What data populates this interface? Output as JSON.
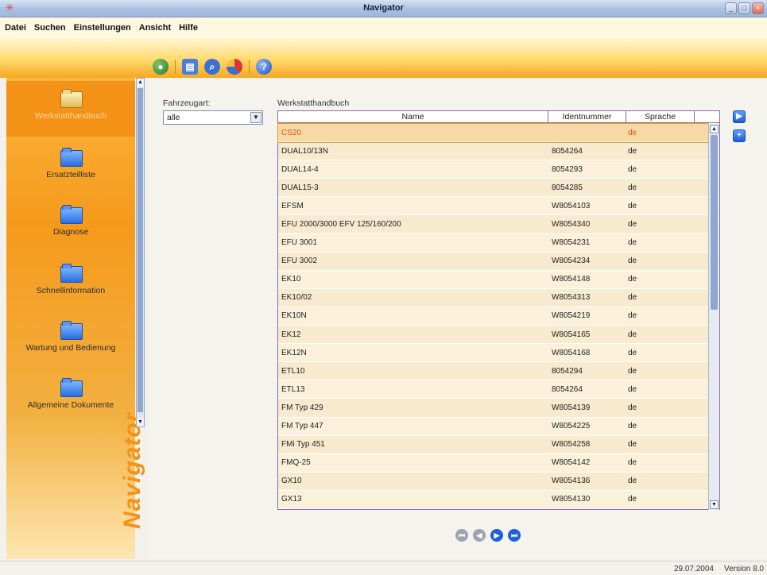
{
  "window": {
    "title": "Navigator"
  },
  "menu": [
    "Datei",
    "Suchen",
    "Einstellungen",
    "Ansicht",
    "Hilfe"
  ],
  "toolbar_icons": [
    "globe-icon",
    "print-icon",
    "search-icon",
    "pie-chart-icon",
    "help-icon"
  ],
  "sidebar": {
    "items": [
      {
        "label": "Werkstatthandbuch",
        "active": true
      },
      {
        "label": "Ersatzteilliste",
        "active": false
      },
      {
        "label": "Diagnose",
        "active": false
      },
      {
        "label": "Schnellinformation",
        "active": false
      },
      {
        "label": "Wartung und Bedienung",
        "active": false
      },
      {
        "label": "Allgemeine Dokumente",
        "active": false
      }
    ],
    "brand": "Navigator"
  },
  "filter": {
    "label": "Fahrzeugart:",
    "value": "alle"
  },
  "list": {
    "title": "Werkstatthandbuch",
    "columns": [
      "Name",
      "Identnummer",
      "Sprache"
    ],
    "rows": [
      [
        "CS20",
        "",
        "de"
      ],
      [
        "DUAL10/13N",
        "8054264",
        "de"
      ],
      [
        "DUAL14-4",
        "8054293",
        "de"
      ],
      [
        "DUAL15-3",
        "8054285",
        "de"
      ],
      [
        "EFSM",
        "W8054103",
        "de"
      ],
      [
        "EFU 2000/3000   EFV 125/160/200",
        "W8054340",
        "de"
      ],
      [
        "EFU 3001",
        "W8054231",
        "de"
      ],
      [
        "EFU 3002",
        "W8054234",
        "de"
      ],
      [
        "EK10",
        "W8054148",
        "de"
      ],
      [
        "EK10/02",
        "W8054313",
        "de"
      ],
      [
        "EK10N",
        "W8054219",
        "de"
      ],
      [
        "EK12",
        "W8054165",
        "de"
      ],
      [
        "EK12N",
        "W8054168",
        "de"
      ],
      [
        "ETL10",
        "8054294",
        "de"
      ],
      [
        "ETL13",
        "8054264",
        "de"
      ],
      [
        "FM Typ 429",
        "W8054139",
        "de"
      ],
      [
        "FM Typ 447",
        "W8054225",
        "de"
      ],
      [
        "FMi Typ 451",
        "W8054258",
        "de"
      ],
      [
        "FMQ-25",
        "W8054142",
        "de"
      ],
      [
        "GX10",
        "W8054136",
        "de"
      ],
      [
        "GX13",
        "W8054130",
        "de"
      ]
    ],
    "selected_row": 0
  },
  "status": {
    "date": "29.07.2004",
    "version": "Version 8.0"
  },
  "colors": {
    "accent": "#f39216",
    "selection_text": "#d9541a",
    "button_blue": "#1e5fd6"
  }
}
